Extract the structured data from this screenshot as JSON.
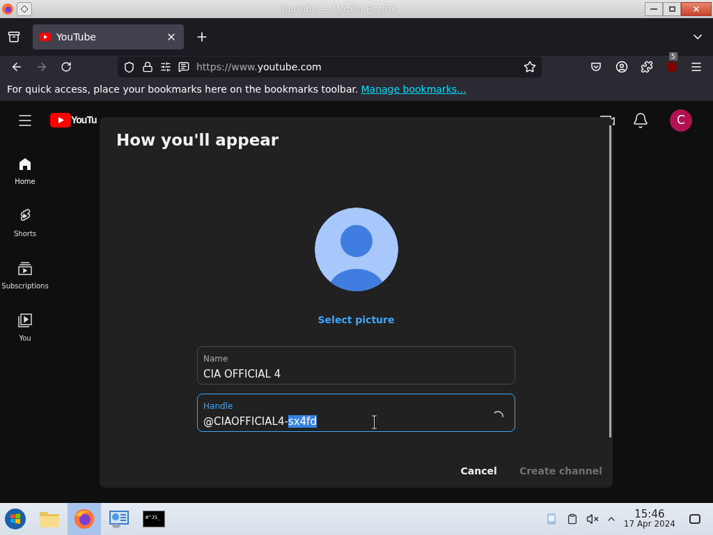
{
  "window": {
    "title": "YouTube — Mozilla Firefox"
  },
  "tabs": [
    {
      "label": "YouTube",
      "selected": true
    }
  ],
  "address_bar": {
    "url_prefix": "https://www.",
    "url_domain": "youtube.com"
  },
  "extension_badge": "5",
  "bookmarks_bar": {
    "message": "For quick access, place your bookmarks here on the bookmarks toolbar.",
    "link": "Manage bookmarks…"
  },
  "youtube": {
    "logo_text": "YouTu",
    "avatar_letter": "C",
    "sidebar": [
      {
        "label": "Home",
        "kind": "home",
        "selected": true
      },
      {
        "label": "Shorts",
        "kind": "shorts",
        "selected": false
      },
      {
        "label": "Subscriptions",
        "kind": "subscriptions",
        "selected": false
      },
      {
        "label": "You",
        "kind": "you",
        "selected": false
      }
    ]
  },
  "dialog": {
    "title": "How you'll appear",
    "select_picture": "Select picture",
    "name_field": {
      "label": "Name",
      "value": "CIA OFFICIAL 4",
      "focused": false
    },
    "handle_field": {
      "label": "Handle",
      "focused": true,
      "loading": true,
      "value_parts": [
        {
          "text": "@CIAOFFICIAL4-",
          "selected": false
        },
        {
          "text": "sx4fd",
          "selected": true
        }
      ]
    },
    "buttons": [
      {
        "label": "Cancel",
        "disabled": false
      },
      {
        "label": "Create channel",
        "disabled": true
      }
    ]
  },
  "taskbar": {
    "apps": [
      {
        "kind": "folder",
        "active": false
      },
      {
        "kind": "firefox",
        "active": true
      },
      {
        "kind": "control-panel",
        "active": false
      },
      {
        "kind": "terminal",
        "active": false,
        "text": "#^JS_"
      }
    ],
    "time": "15:46",
    "date": "17 Apr 2024"
  }
}
